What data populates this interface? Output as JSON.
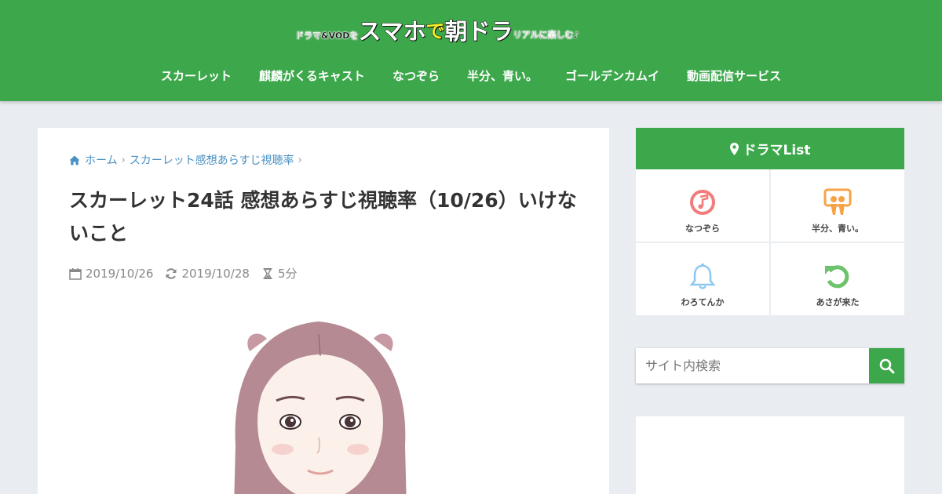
{
  "site": {
    "logo_parts": [
      "ドラマ&VODを",
      "スマホ",
      "で",
      "朝ドラ",
      "リアルに楽しむ♪"
    ]
  },
  "nav": {
    "items": [
      "スカーレット",
      "麒麟がくるキャスト",
      "なつぞら",
      "半分、青い。",
      "ゴールデンカムイ",
      "動画配信サービス"
    ]
  },
  "breadcrumb": {
    "home": "ホーム",
    "category": "スカーレット感想あらすじ視聴率"
  },
  "article": {
    "title": "スカーレット24話 感想あらすじ視聴率（10/26）いけないこと",
    "published": "2019/10/26",
    "updated": "2019/10/28",
    "read_time": "5分"
  },
  "sidebar": {
    "heading": "ドラマList",
    "items": [
      {
        "label": "なつぞら",
        "icon": "music-note-icon",
        "color": "#f27c7c"
      },
      {
        "label": "半分、青い。",
        "icon": "slideshare-icon",
        "color": "#f6a347"
      },
      {
        "label": "わろてんか",
        "icon": "bell-icon",
        "color": "#8cc8f0"
      },
      {
        "label": "あさが来た",
        "icon": "undo-icon",
        "color": "#6dc26d"
      }
    ],
    "search_placeholder": "サイト内検索"
  },
  "colors": {
    "brand_green": "#3da84b",
    "link_blue": "#4a90c2",
    "background": "#e9ecf0"
  }
}
